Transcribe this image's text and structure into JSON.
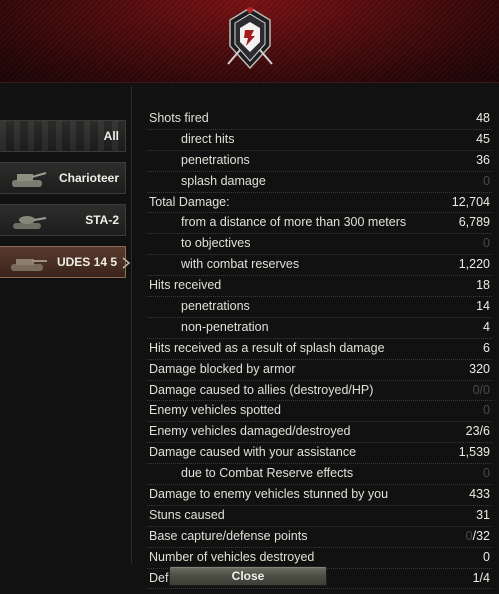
{
  "tabs": [
    {
      "label": "All",
      "active": false,
      "icon": "all-vehicles-icon"
    },
    {
      "label": "Charioteer",
      "active": false,
      "icon": "tank-icon"
    },
    {
      "label": "STA-2",
      "active": false,
      "icon": "tank-icon"
    },
    {
      "label": "UDES 14 5",
      "active": true,
      "icon": "tank-icon"
    }
  ],
  "stats": [
    {
      "label": "Shots fired",
      "value": "48",
      "sub": false
    },
    {
      "label": "direct hits",
      "value": "45",
      "sub": true
    },
    {
      "label": "penetrations",
      "value": "36",
      "sub": true
    },
    {
      "label": "splash damage",
      "value": "0",
      "sub": true,
      "dim": true
    },
    {
      "label": "Total Damage:",
      "value": "12,704",
      "sub": false
    },
    {
      "label": "from a distance of more than 300 meters",
      "value": "6,789",
      "sub": true
    },
    {
      "label": "to objectives",
      "value": "0",
      "sub": true,
      "dim": true
    },
    {
      "label": "with combat reserves",
      "value": "1,220",
      "sub": true
    },
    {
      "label": "Hits received",
      "value": "18",
      "sub": false
    },
    {
      "label": "penetrations",
      "value": "14",
      "sub": true
    },
    {
      "label": "non-penetration",
      "value": "4",
      "sub": true
    },
    {
      "label": "Hits received as a result of splash damage",
      "value": "6",
      "sub": false
    },
    {
      "label": "Damage blocked by armor",
      "value": "320",
      "sub": false
    },
    {
      "label": "Damage caused to allies (destroyed/HP)",
      "value": "0/0",
      "sub": false,
      "dim": true
    },
    {
      "label": "Enemy vehicles spotted",
      "value": "0",
      "sub": false,
      "dim": true
    },
    {
      "label": "Enemy vehicles damaged/destroyed",
      "value": "23/6",
      "sub": false
    },
    {
      "label": "Damage caused with your assistance",
      "value": "1,539",
      "sub": false
    },
    {
      "label": "due to Combat Reserve effects",
      "value": "0",
      "sub": true,
      "dim": true
    },
    {
      "label": "Damage to enemy vehicles stunned by you",
      "value": "433",
      "sub": false
    },
    {
      "label": "Stuns caused",
      "value": "31",
      "sub": false
    },
    {
      "label": "Base capture/defense points",
      "value": "0/32",
      "sub": false,
      "partial_dim": "0"
    },
    {
      "label": "Number of vehicles destroyed",
      "value": "0",
      "sub": false
    },
    {
      "label": "Defended Zones / Objectives",
      "value": "1/4",
      "sub": false
    }
  ],
  "close_label": "Close",
  "colors": {
    "header_red": "#6a0f12",
    "active_tab": "#5a3a2e",
    "dim_value": "#4a4a48"
  }
}
